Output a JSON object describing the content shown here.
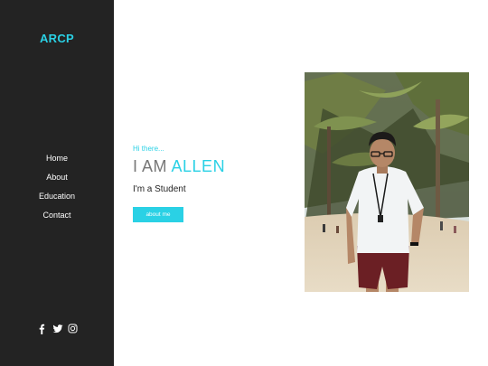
{
  "sidebar": {
    "logo": "ARCP",
    "nav": [
      {
        "label": "Home"
      },
      {
        "label": "About"
      },
      {
        "label": "Education"
      },
      {
        "label": "Contact"
      }
    ],
    "social": [
      "facebook-icon",
      "twitter-icon",
      "instagram-icon"
    ]
  },
  "hero": {
    "greeting": "Hi there...",
    "headline_prefix": "I AM ",
    "headline_name": "ALLEN",
    "role": "I'm a Student",
    "button_label": "about me"
  },
  "colors": {
    "accent": "#2ad1e5",
    "sidebar_bg": "#232323"
  }
}
